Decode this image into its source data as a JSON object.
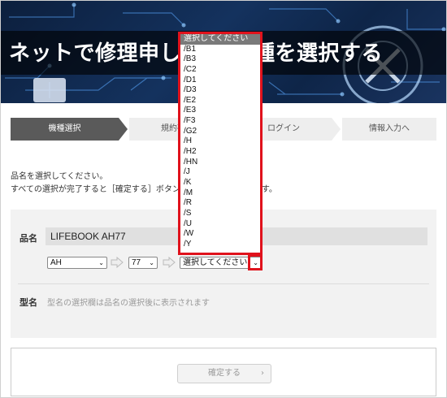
{
  "hero": {
    "title": "ネットで修理申し込み 機種を選択する"
  },
  "steps": [
    "機種選択",
    "規約確認",
    "ログイン",
    "情報入力へ"
  ],
  "instructions": {
    "line1": "品名を選択してください。",
    "line2": "すべての選択が完了すると［確定する］ボタンが押せるようになります。"
  },
  "form": {
    "product_label": "品名",
    "product_value": "LIFEBOOK AH77",
    "select1": "AH",
    "select2": "77",
    "select3": "選択してください",
    "model_label": "型名",
    "model_hint": "型名の選択欄は品名の選択後に表示されます"
  },
  "confirm_button": "確定する",
  "dropdown": {
    "selected": "選択してください",
    "options": [
      "選択してください",
      "/B1",
      "/B3",
      "/C2",
      "/D1",
      "/D3",
      "/E2",
      "/E3",
      "/F3",
      "/G2",
      "/H",
      "/H2",
      "/HN",
      "/J",
      "/K",
      "/M",
      "/R",
      "/S",
      "/U",
      "/W",
      "/Y"
    ]
  },
  "colors": {
    "highlight": "#e0121c",
    "active_step": "#5a5a5a",
    "selected_option": "#7a7a7a"
  },
  "icons": {
    "arrow": "arrow-right-icon",
    "chevron": "chevron-down-icon",
    "confirm": "chevron-right-icon"
  }
}
